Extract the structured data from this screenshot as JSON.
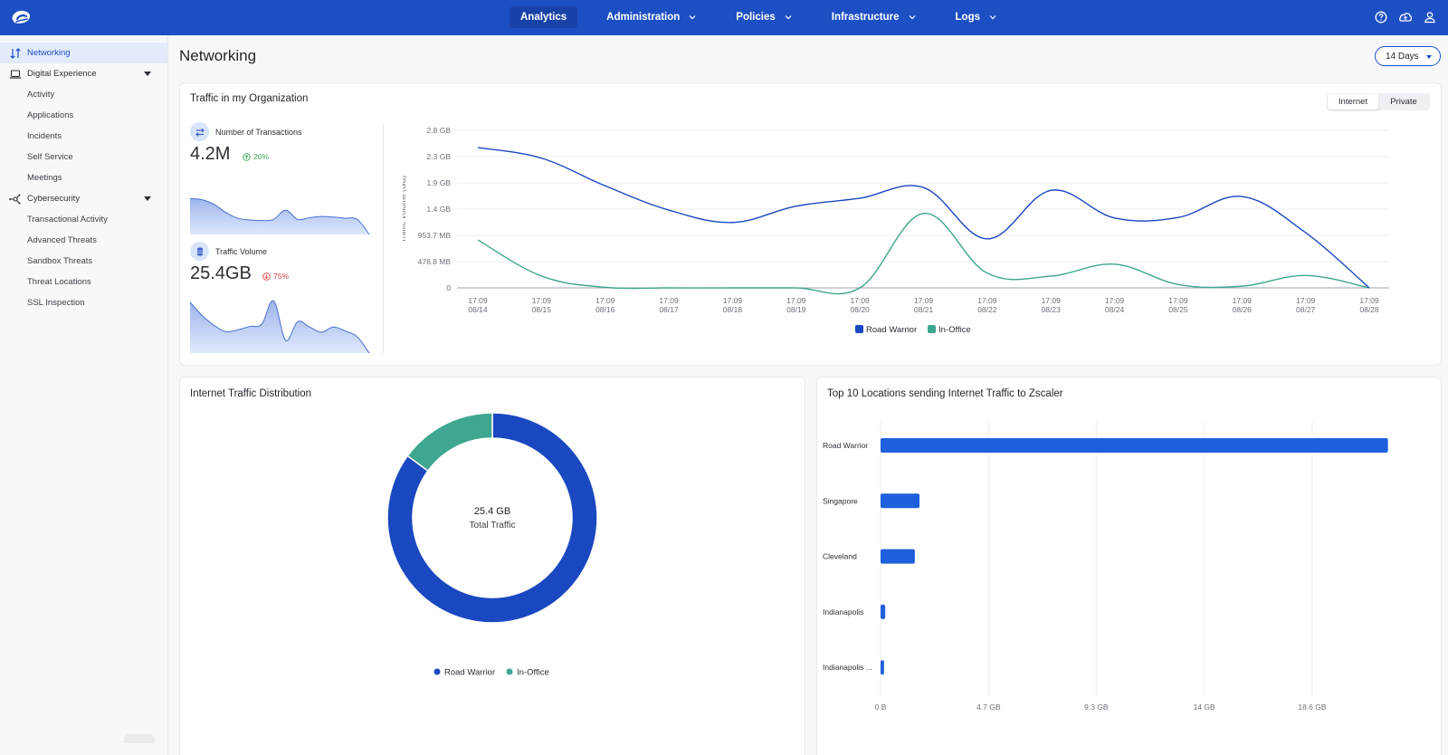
{
  "topbar": {
    "nav": [
      {
        "label": "Analytics",
        "active": true,
        "dropdown": false
      },
      {
        "label": "Administration",
        "active": false,
        "dropdown": true
      },
      {
        "label": "Policies",
        "active": false,
        "dropdown": true
      },
      {
        "label": "Infrastructure",
        "active": false,
        "dropdown": true
      },
      {
        "label": "Logs",
        "active": false,
        "dropdown": true
      }
    ],
    "icons": [
      "help-icon",
      "cloud-upload-icon",
      "user-icon"
    ]
  },
  "sidebar": {
    "networking": "Networking",
    "digital_experience": "Digital Experience",
    "dx_items": [
      "Activity",
      "Applications",
      "Incidents",
      "Self Service",
      "Meetings"
    ],
    "cybersecurity": "Cybersecurity",
    "cs_items": [
      "Transactional Activity",
      "Advanced Threats",
      "Sandbox Threats",
      "Threat Locations",
      "SSL Inspection"
    ]
  },
  "page": {
    "title": "Networking",
    "range": "14 Days"
  },
  "traffic_card": {
    "title": "Traffic in my Organization",
    "toggle": {
      "options": [
        "Internet",
        "Private"
      ],
      "selected": "Internet"
    },
    "kpis": [
      {
        "label": "Number of Transactions",
        "value": "4.2M",
        "delta": "20%",
        "direction": "up",
        "spark": [
          0.62,
          0.6,
          0.52,
          0.38,
          0.28,
          0.25,
          0.24,
          0.26,
          0.42,
          0.26,
          0.29,
          0.31,
          0.3,
          0.28,
          0.26,
          0.0
        ]
      },
      {
        "label": "Traffic Volume",
        "value": "25.4GB",
        "delta": "75%",
        "direction": "down",
        "spark": [
          0.88,
          0.65,
          0.48,
          0.37,
          0.4,
          0.46,
          0.5,
          0.9,
          0.22,
          0.54,
          0.45,
          0.36,
          0.45,
          0.38,
          0.28,
          0.0
        ]
      }
    ]
  },
  "chart_data": [
    {
      "type": "line",
      "title": "Traffic in my Organization",
      "ylabel": "Traffic Volume (GB)",
      "xlabel": "",
      "x": [
        "17:09 08/14",
        "17:09 08/15",
        "17:09 08/16",
        "17:09 08/17",
        "17:09 08/18",
        "17:09 08/19",
        "17:09 08/20",
        "17:09 08/21",
        "17:09 08/22",
        "17:09 08/23",
        "17:09 08/24",
        "17:09 08/25",
        "17:09 08/26",
        "17:09 08/27",
        "17:09 08/28"
      ],
      "yticks": [
        "0",
        "476.8 MB",
        "953.7 MB",
        "1.4 GB",
        "1.9 GB",
        "2.3 GB",
        "2.8 GB"
      ],
      "ylim_gb": [
        0,
        2.794
      ],
      "series": [
        {
          "name": "Road Warrior",
          "color": "#1a48c0",
          "values": [
            2.49,
            2.3,
            1.81,
            1.38,
            1.16,
            1.45,
            1.59,
            1.78,
            0.87,
            1.73,
            1.24,
            1.25,
            1.62,
            0.98,
            0.0
          ]
        },
        {
          "name": "In-Office",
          "color": "#3fa68f",
          "values": [
            0.85,
            0.21,
            0.01,
            0.0,
            0.0,
            0.0,
            0.0,
            1.32,
            0.26,
            0.21,
            0.42,
            0.06,
            0.03,
            0.22,
            0.0
          ]
        }
      ],
      "legend": "bottom",
      "grid": true
    },
    {
      "type": "pie",
      "title": "Internet Traffic Distribution",
      "center_value": "25.4 GB",
      "center_label": "Total Traffic",
      "slices": [
        {
          "name": "Road Warrior",
          "value": 21.6,
          "color": "#1a48c0"
        },
        {
          "name": "In-Office",
          "value": 3.8,
          "color": "#3fa68f"
        }
      ],
      "legend": "bottom"
    },
    {
      "type": "bar",
      "orientation": "horizontal",
      "title": "Top 10 Locations sending Internet Traffic to Zscaler",
      "categories": [
        "Road Warrior",
        "Singapore",
        "Cleveland",
        "Indianapolis",
        "Indianapolis ..."
      ],
      "values": [
        21.9,
        1.68,
        1.48,
        0.2,
        0.15
      ],
      "unit": "GB",
      "xticks": [
        "0 B",
        "4.7 GB",
        "9.3 GB",
        "14 GB",
        "18.6 GB"
      ],
      "xtick_values": [
        0,
        4.66,
        9.31,
        13.97,
        18.63
      ],
      "color": "#1f5fdc",
      "grid": true
    }
  ]
}
